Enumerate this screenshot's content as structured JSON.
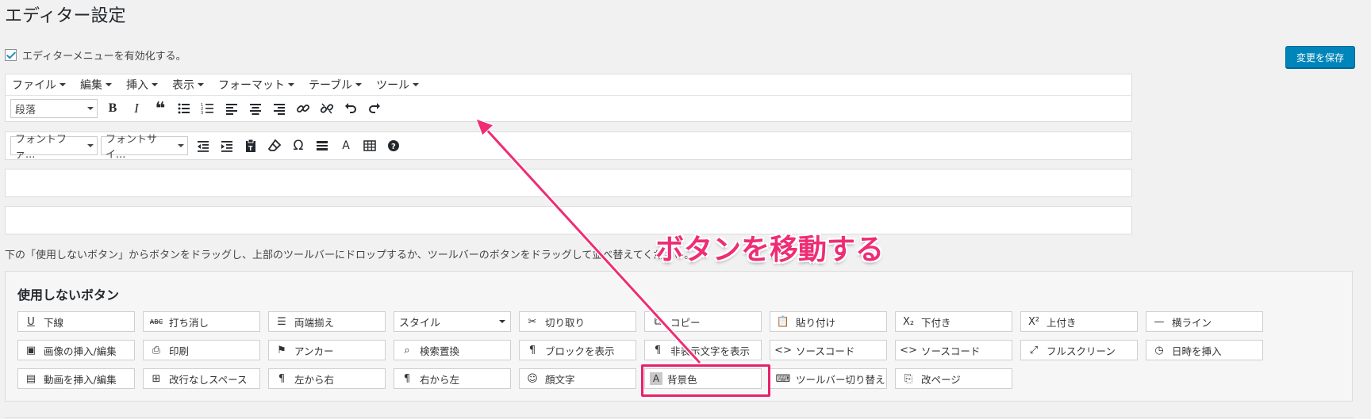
{
  "page": {
    "title": "エディター設定"
  },
  "enable_menu": {
    "label": "エディターメニューを有効化する。",
    "checked": true
  },
  "save_button": {
    "label": "変更を保存"
  },
  "menubar": {
    "items": [
      {
        "label": "ファイル"
      },
      {
        "label": "編集"
      },
      {
        "label": "挿入"
      },
      {
        "label": "表示"
      },
      {
        "label": "フォーマット"
      },
      {
        "label": "テーブル"
      },
      {
        "label": "ツール"
      }
    ]
  },
  "toolbar1": {
    "format_select": "段落",
    "icons": [
      "bold-icon",
      "italic-icon",
      "blockquote-icon",
      "bullet-list-icon",
      "numbered-list-icon",
      "align-left-icon",
      "align-center-icon",
      "align-right-icon",
      "link-icon",
      "unlink-icon",
      "undo-icon",
      "redo-icon"
    ]
  },
  "toolbar2": {
    "font_family_select": "フォントファ...",
    "font_size_select": "フォントサイ...",
    "icons": [
      "outdent-icon",
      "indent-icon",
      "paste-text-icon",
      "clear-format-icon",
      "special-char-icon",
      "horizontal-rule-icon",
      "text-color-icon",
      "table-icon",
      "help-icon"
    ]
  },
  "help_text": "下の「使用しないボタン」からボタンをドラッグし、上部のツールバーにドロップするか、ツールバーのボタンをドラッグして並べ替えてください。",
  "unused": {
    "title": "使用しないボタン",
    "rows": [
      [
        {
          "label": "下線",
          "icon": "U"
        },
        {
          "label": "打ち消し",
          "icon": "ABC"
        },
        {
          "label": "両端揃え",
          "icon": "☰"
        },
        {
          "label": "スタイル",
          "icon": ""
        },
        {
          "label": "切り取り",
          "icon": "✂"
        },
        {
          "label": "コピー",
          "icon": "⧉"
        },
        {
          "label": "貼り付け",
          "icon": "📋"
        },
        {
          "label": "下付き",
          "icon": "X₂"
        },
        {
          "label": "上付き",
          "icon": "X²"
        },
        {
          "label": "横ライン",
          "icon": "—"
        }
      ],
      [
        {
          "label": "画像の挿入/編集",
          "icon": "▣"
        },
        {
          "label": "印刷",
          "icon": "⎙"
        },
        {
          "label": "アンカー",
          "icon": "⚑"
        },
        {
          "label": "検索置換",
          "icon": "⌕"
        },
        {
          "label": "ブロックを表示",
          "icon": "¶"
        },
        {
          "label": "非表示文字を表示",
          "icon": "¶"
        },
        {
          "label": "ソースコード",
          "icon": "<>"
        },
        {
          "label": "ソースコード",
          "icon": "<>"
        },
        {
          "label": "フルスクリーン",
          "icon": "⤢"
        },
        {
          "label": "日時を挿入",
          "icon": "◷"
        }
      ],
      [
        {
          "label": "動画を挿入/編集",
          "icon": "▤"
        },
        {
          "label": "改行なしスペース",
          "icon": "⊞"
        },
        {
          "label": "左から右",
          "icon": "¶"
        },
        {
          "label": "右から左",
          "icon": "¶"
        },
        {
          "label": "顔文字",
          "icon": "☺"
        },
        {
          "label": "背景色",
          "icon": "A"
        },
        {
          "label": "ツールバー切り替え",
          "icon": "⌨"
        },
        {
          "label": "改ページ",
          "icon": "⎘"
        }
      ]
    ]
  },
  "annotation": {
    "label": "ボタンを移動する",
    "color": "#ee2d74"
  }
}
